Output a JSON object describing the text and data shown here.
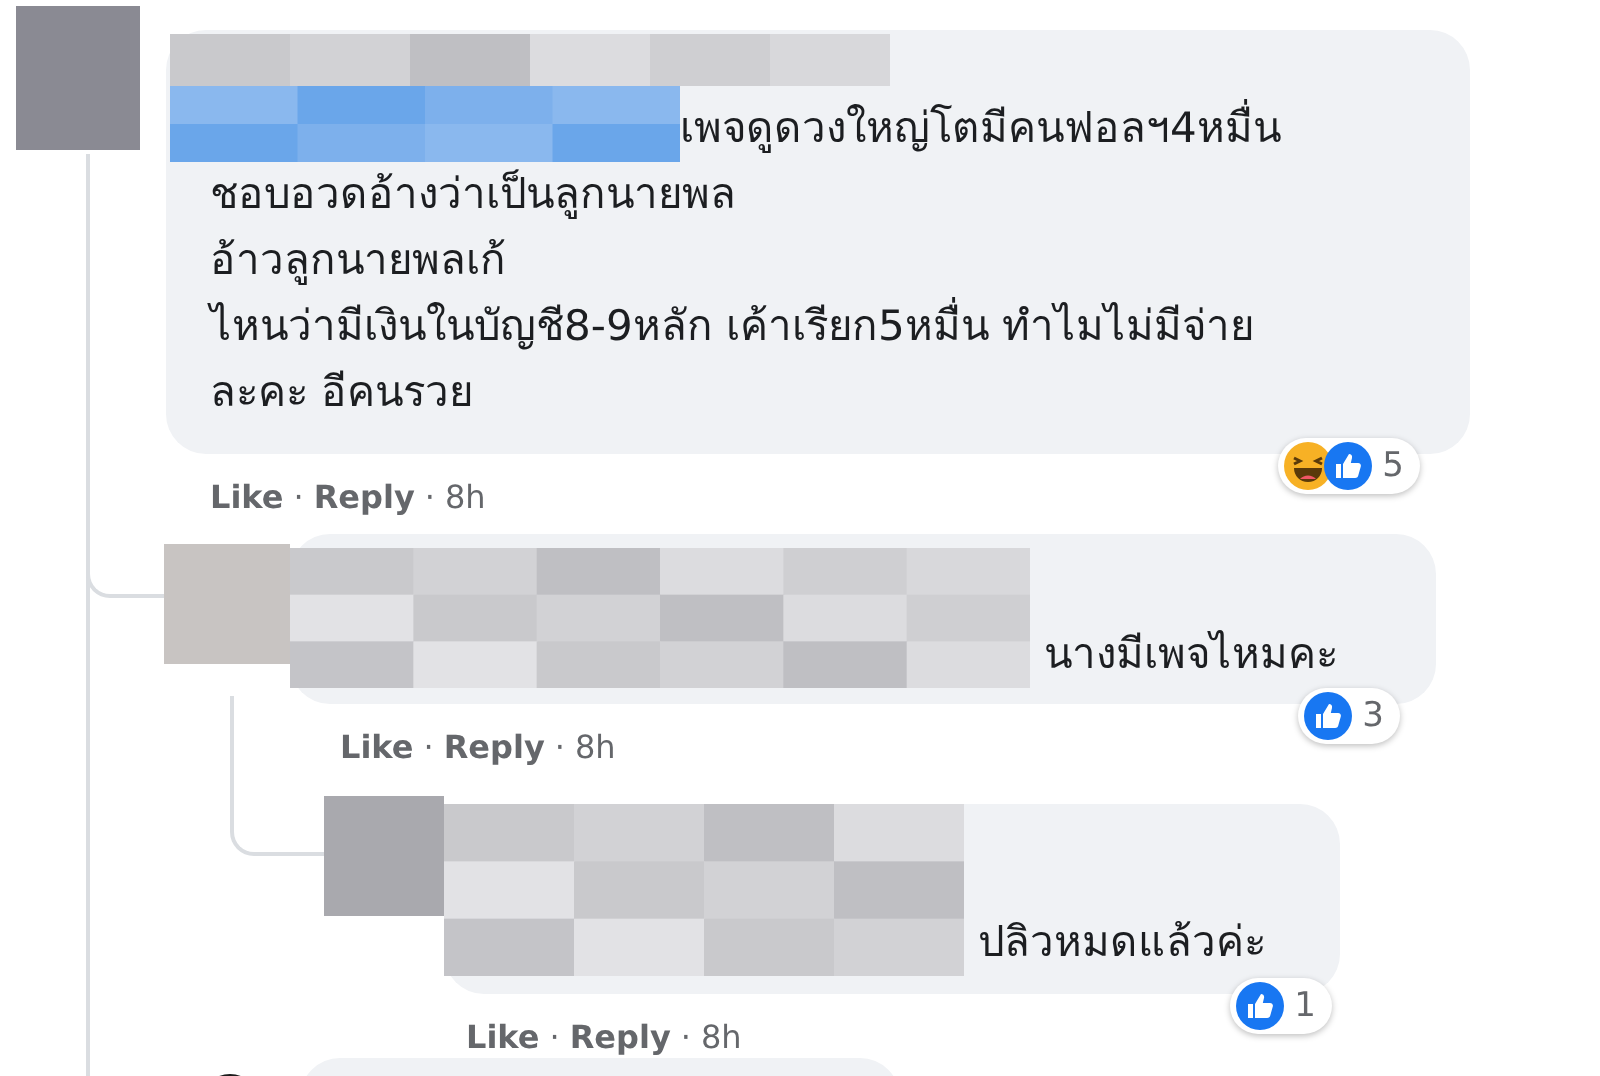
{
  "comments": [
    {
      "kind": "full",
      "lines": [
        "เพจดูดวงใหญ่โตมีคนฟอลฯ4หมื่น",
        "ชอบอวดอ้างว่าเป็นลูกนายพล",
        "อ้าวลูกนายพลเก้",
        "ไหนว่ามีเงินในบัญชี8-9หลัก เค้าเรียก5หมื่น ทำไมไม่มีจ่าย",
        "ละคะ อีคนรวย"
      ],
      "actions": [
        {
          "label": "Like",
          "kind": "link"
        },
        {
          "label": "·",
          "kind": "dot"
        },
        {
          "label": "Reply",
          "kind": "link"
        },
        {
          "label": "·",
          "kind": "dot"
        },
        {
          "label": "8h",
          "kind": "time"
        }
      ],
      "reactions": [
        {
          "kind": "haha"
        },
        {
          "kind": "like"
        }
      ],
      "reaction_count": "5",
      "replies": [
        {
          "kind": "full",
          "lines": [
            "นางมีเพจไหมคะ"
          ],
          "actions": [
            {
              "label": "Like",
              "kind": "link"
            },
            {
              "label": "·",
              "kind": "dot"
            },
            {
              "label": "Reply",
              "kind": "link"
            },
            {
              "label": "·",
              "kind": "dot"
            },
            {
              "label": "8h",
              "kind": "time"
            }
          ],
          "reactions": [
            {
              "kind": "like"
            }
          ],
          "reaction_count": "3",
          "replies": [
            {
              "kind": "full",
              "lines": [
                "ปลิวหมดแล้วค่ะ"
              ],
              "actions": [
                {
                  "label": "Like",
                  "kind": "link"
                },
                {
                  "label": "·",
                  "kind": "dot"
                },
                {
                  "label": "Reply",
                  "kind": "link"
                },
                {
                  "label": "·",
                  "kind": "dot"
                },
                {
                  "label": "8h",
                  "kind": "time"
                }
              ],
              "reactions": [
                {
                  "kind": "like"
                }
              ],
              "reaction_count": "1"
            }
          ]
        },
        {
          "kind": "cut_off"
        }
      ]
    }
  ]
}
